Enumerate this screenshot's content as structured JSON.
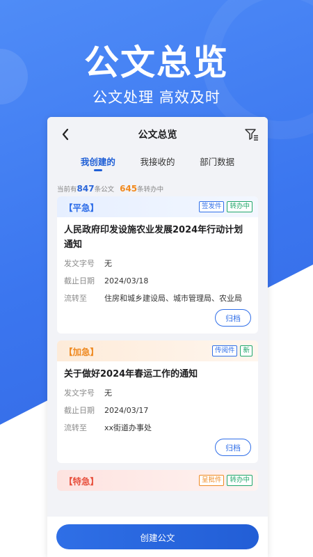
{
  "hero": {
    "title": "公文总览",
    "subtitle": "公文处理 高效及时"
  },
  "nav": {
    "title": "公文总览",
    "back_icon": "chevron-left-icon",
    "filter_icon": "filter-list-icon"
  },
  "tabs": [
    {
      "label": "我创建的",
      "active": true
    },
    {
      "label": "我接收的",
      "active": false
    },
    {
      "label": "部门数据",
      "active": false
    }
  ],
  "summary": {
    "prefix": "当前有",
    "total": "847",
    "mid": "条公文",
    "forwarding": "645",
    "suffix": "条转办中"
  },
  "field_labels": {
    "doc_no": "发文字号",
    "deadline": "截止日期",
    "route": "流转至"
  },
  "cards": [
    {
      "urgency": "【平急】",
      "badges": [
        "签发件",
        "转办中"
      ],
      "title": "人民政府印发设施农业发展2024年行动计划通知",
      "doc_no": "无",
      "deadline": "2024/03/18",
      "route": "住房和城乡建设局、城市管理局、农业局",
      "action": "归档"
    },
    {
      "urgency": "【加急】",
      "badges": [
        "传阅件",
        "新"
      ],
      "title": "关于做好2024年春运工作的通知",
      "doc_no": "无",
      "deadline": "2024/03/17",
      "route": "xx街道办事处",
      "action": "归档"
    },
    {
      "urgency": "【特急】",
      "badges": [
        "呈批件",
        "转办中"
      ]
    }
  ],
  "bottom": {
    "create_label": "创建公文"
  },
  "colors": {
    "accent": "#2f6ee8",
    "blue_urgency": "#2f6ee8",
    "orange_urgency": "#ef8a22",
    "red_urgency": "#e8523f",
    "green_badge": "#1fa66a"
  }
}
